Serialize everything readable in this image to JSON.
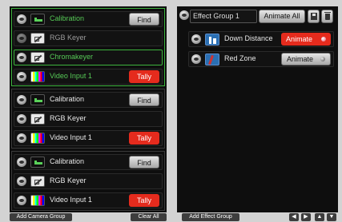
{
  "camera_groups": [
    {
      "rows": [
        {
          "label": "Calibration",
          "label_style": "green",
          "thumb": "calibration-icon",
          "button": "Find",
          "button_type": "find",
          "selected": false,
          "dim": false
        },
        {
          "label": "RGB Keyer",
          "label_style": "grey",
          "thumb": "keyer-icon",
          "button": "",
          "button_type": "none",
          "selected": false,
          "dim": true
        },
        {
          "label": "Chromakeyer",
          "label_style": "green",
          "thumb": "keyer-icon",
          "button": "",
          "button_type": "none",
          "selected": true,
          "dim": false
        },
        {
          "label": "Video Input 1",
          "label_style": "green",
          "thumb": "video-icon",
          "button": "Tally",
          "button_type": "tally",
          "selected": false,
          "dim": false
        }
      ]
    },
    {
      "rows": [
        {
          "label": "Calibration",
          "label_style": "white",
          "thumb": "calibration-icon",
          "button": "Find",
          "button_type": "find",
          "selected": false,
          "dim": false
        },
        {
          "label": "RGB Keyer",
          "label_style": "white",
          "thumb": "keyer-icon",
          "button": "",
          "button_type": "none",
          "selected": false,
          "dim": false
        },
        {
          "label": "Video Input 1",
          "label_style": "white",
          "thumb": "video-icon",
          "button": "Tally",
          "button_type": "tally",
          "selected": false,
          "dim": false
        }
      ]
    },
    {
      "rows": [
        {
          "label": "Calibration",
          "label_style": "white",
          "thumb": "calibration-icon",
          "button": "Find",
          "button_type": "find",
          "selected": false,
          "dim": false
        },
        {
          "label": "RGB Keyer",
          "label_style": "white",
          "thumb": "keyer-icon",
          "button": "",
          "button_type": "none",
          "selected": false,
          "dim": false
        },
        {
          "label": "Video Input 1",
          "label_style": "white",
          "thumb": "video-icon",
          "button": "Tally",
          "button_type": "tally",
          "selected": false,
          "dim": false
        }
      ]
    }
  ],
  "left_footer": {
    "add_camera_group": "Add Camera Group",
    "clear_all": "Clear All"
  },
  "effect_group": {
    "name": "Effect Group 1",
    "animate_all": "Animate All",
    "effects": [
      {
        "label": "Down Distance",
        "thumb": "down-distance-icon",
        "button": "Animate",
        "state": "on"
      },
      {
        "label": "Red Zone",
        "thumb": "red-zone-icon",
        "button": "Animate",
        "state": "off"
      }
    ]
  },
  "right_footer": {
    "add_effect_group": "Add Effect Group",
    "nav": [
      "◀",
      "▶",
      "▲",
      "▼"
    ]
  },
  "colors": {
    "accent_green": "#3db43d",
    "tally_red": "#e52b1d",
    "panel_bg": "#0e0e0e"
  }
}
